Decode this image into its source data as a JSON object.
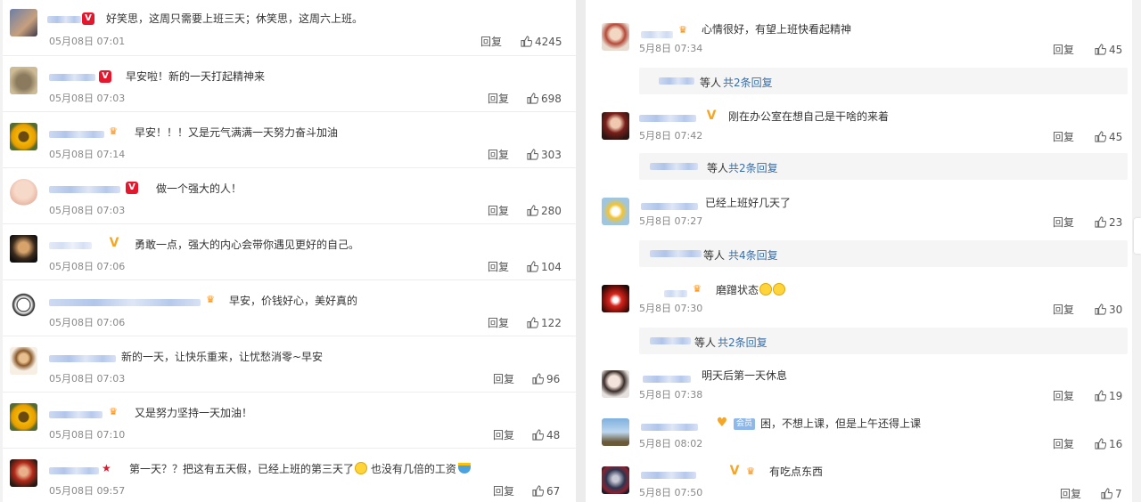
{
  "left": {
    "comments": [
      {
        "text": "好笑思，这周只需要上班三天；休笑思，这周六上班。",
        "time": "05月08日 07:01",
        "reply": "回复",
        "likes": "4245"
      },
      {
        "text": "早安啦！新的一天打起精神来",
        "time": "05月08日 07:03",
        "reply": "回复",
        "likes": "698"
      },
      {
        "text": "早安！！！又是元气满满一天努力奋斗加油",
        "time": "05月08日 07:14",
        "reply": "回复",
        "likes": "303"
      },
      {
        "text": "做一个强大的人！",
        "time": "05月08日 07:03",
        "reply": "回复",
        "likes": "280"
      },
      {
        "text": "勇敢一点，强大的内心会带你遇见更好的自己。",
        "time": "05月08日 07:06",
        "reply": "回复",
        "likes": "104"
      },
      {
        "text": "早安，价钱好心，美好真的",
        "time": "05月08日 07:06",
        "reply": "回复",
        "likes": "122"
      },
      {
        "text": "新的一天，让快乐重来，让忧愁消零~早安",
        "time": "05月08日 07:03",
        "reply": "回复",
        "likes": "96"
      },
      {
        "text": "又是努力坚持一天加油！",
        "time": "05月08日 07:10",
        "reply": "回复",
        "likes": "48"
      },
      {
        "text": "第一天？？把这有五天假，已经上班的第三天了",
        "text2": "也没有几倍的工资",
        "time": "05月08日 09:57",
        "reply": "回复",
        "likes": "67"
      }
    ]
  },
  "right": {
    "comments": [
      {
        "text": "心情很好，有望上班快看起精神",
        "time": "5月8日 07:34",
        "reply": "回复",
        "likes": "45",
        "sub": {
          "people": "等人",
          "link": "共2条回复"
        }
      },
      {
        "text": "刚在办公室在想自己是干啥的来着",
        "time": "5月8日 07:42",
        "reply": "回复",
        "likes": "45",
        "sub": {
          "people": "等人",
          "link": "共2条回复"
        }
      },
      {
        "text": "已经上班好几天了",
        "time": "5月8日 07:27",
        "reply": "回复",
        "likes": "23",
        "sub": {
          "people": "等人",
          "link": "共4条回复"
        }
      },
      {
        "text": "磨蹭状态",
        "time": "5月8日 07:30",
        "reply": "回复",
        "likes": "30",
        "sub": {
          "people": "等人",
          "link": "共2条回复"
        }
      },
      {
        "text": "明天后第一天休息",
        "time": "5月8日 07:38",
        "reply": "回复",
        "likes": "19"
      },
      {
        "text": "困，不想上课，但是上午还得上课",
        "time": "5月8日 08:02",
        "reply": "回复",
        "likes": "16",
        "badge": "会员"
      },
      {
        "text": "有吃点东西",
        "time": "5月8日 07:50",
        "reply": "回复",
        "likes": "7"
      }
    ]
  },
  "colors": {
    "link": "#3a6ea5",
    "vip_red": "#e6162d",
    "crown": "#ff8a00"
  },
  "icons": {
    "like": "thumbs-up-icon",
    "vip": "vip-badge-icon",
    "crown": "crown-icon"
  }
}
